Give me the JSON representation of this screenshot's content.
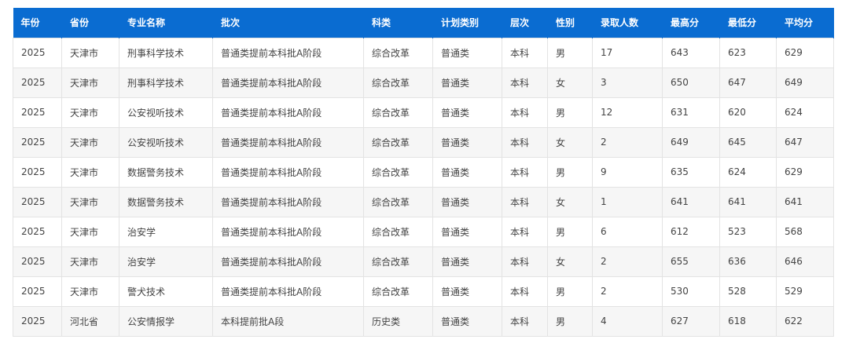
{
  "table": {
    "headers": [
      "年份",
      "省份",
      "专业名称",
      "批次",
      "科类",
      "计划类别",
      "层次",
      "性别",
      "录取人数",
      "最高分",
      "最低分",
      "平均分"
    ],
    "rows": [
      [
        "2025",
        "天津市",
        "刑事科学技术",
        "普通类提前本科批A阶段",
        "综合改革",
        "普通类",
        "本科",
        "男",
        "17",
        "643",
        "623",
        "629"
      ],
      [
        "2025",
        "天津市",
        "刑事科学技术",
        "普通类提前本科批A阶段",
        "综合改革",
        "普通类",
        "本科",
        "女",
        "3",
        "650",
        "647",
        "649"
      ],
      [
        "2025",
        "天津市",
        "公安视听技术",
        "普通类提前本科批A阶段",
        "综合改革",
        "普通类",
        "本科",
        "男",
        "12",
        "631",
        "620",
        "624"
      ],
      [
        "2025",
        "天津市",
        "公安视听技术",
        "普通类提前本科批A阶段",
        "综合改革",
        "普通类",
        "本科",
        "女",
        "2",
        "649",
        "645",
        "647"
      ],
      [
        "2025",
        "天津市",
        "数据警务技术",
        "普通类提前本科批A阶段",
        "综合改革",
        "普通类",
        "本科",
        "男",
        "9",
        "635",
        "624",
        "629"
      ],
      [
        "2025",
        "天津市",
        "数据警务技术",
        "普通类提前本科批A阶段",
        "综合改革",
        "普通类",
        "本科",
        "女",
        "1",
        "641",
        "641",
        "641"
      ],
      [
        "2025",
        "天津市",
        "治安学",
        "普通类提前本科批A阶段",
        "综合改革",
        "普通类",
        "本科",
        "男",
        "6",
        "612",
        "523",
        "568"
      ],
      [
        "2025",
        "天津市",
        "治安学",
        "普通类提前本科批A阶段",
        "综合改革",
        "普通类",
        "本科",
        "女",
        "2",
        "655",
        "636",
        "646"
      ],
      [
        "2025",
        "天津市",
        "警犬技术",
        "普通类提前本科批A阶段",
        "综合改革",
        "普通类",
        "本科",
        "男",
        "2",
        "530",
        "528",
        "529"
      ],
      [
        "2025",
        "河北省",
        "公安情报学",
        "本科提前批A段",
        "历史类",
        "普通类",
        "本科",
        "男",
        "4",
        "627",
        "618",
        "622"
      ]
    ]
  },
  "colors": {
    "header_bg": "#0a6cd1",
    "header_text": "#ffffff",
    "row_alt_bg": "#f6f6f6",
    "cell_text": "#444444"
  }
}
